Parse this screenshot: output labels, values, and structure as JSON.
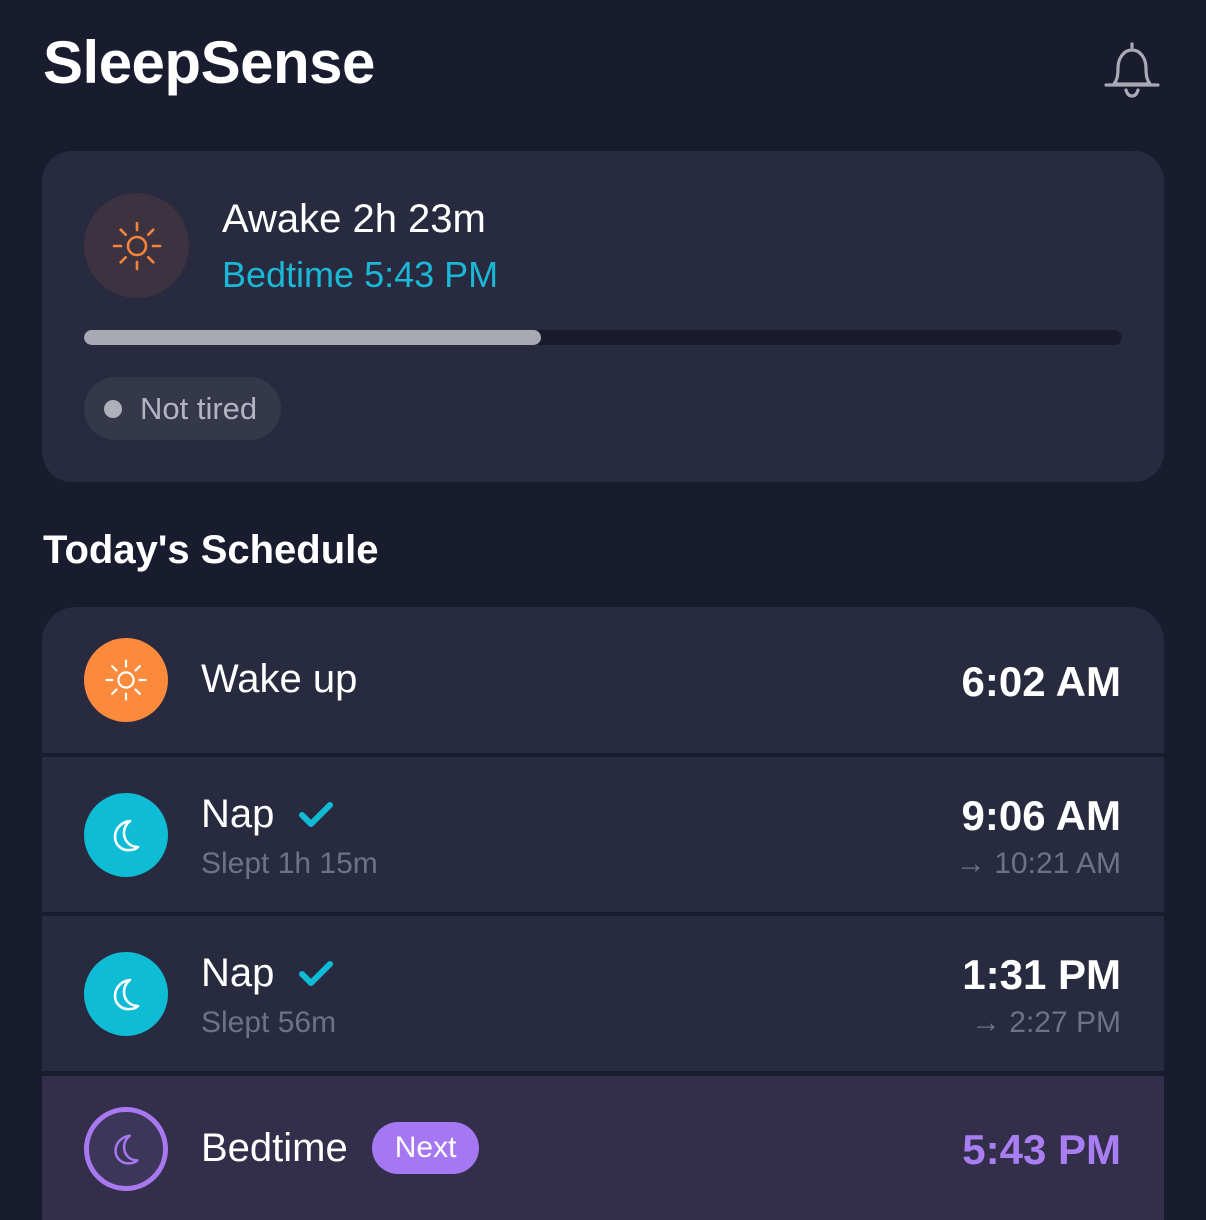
{
  "app": {
    "title": "SleepSense"
  },
  "status": {
    "awake_label": "Awake 2h 23m",
    "bedtime_label": "Bedtime 5:43 PM",
    "progress_fraction": 0.44,
    "tired_label": "Not tired"
  },
  "schedule": {
    "title": "Today's Schedule",
    "items": [
      {
        "type": "wake",
        "title": "Wake up",
        "time": "6:02 AM"
      },
      {
        "type": "nap",
        "title": "Nap",
        "completed": true,
        "subtitle": "Slept 1h 15m",
        "time": "9:06 AM",
        "end_time": "→ 10:21 AM"
      },
      {
        "type": "nap",
        "title": "Nap",
        "completed": true,
        "subtitle": "Slept 56m",
        "time": "1:31 PM",
        "end_time": "→ 2:27 PM"
      },
      {
        "type": "bedtime",
        "title": "Bedtime",
        "badge": "Next",
        "time": "5:43 PM"
      }
    ]
  },
  "colors": {
    "background": "#191b2e",
    "card": "#282a3f",
    "accent_cyan": "#1ab8d6",
    "accent_orange": "#fb8a3c",
    "accent_purple": "#a677f2"
  }
}
